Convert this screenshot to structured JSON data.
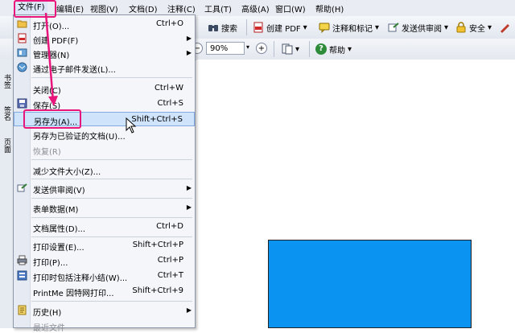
{
  "menubar": {
    "items": [
      "文件(F)",
      "编辑(E)",
      "视图(V)",
      "文档(D)",
      "注释(C)",
      "工具(T)",
      "高级(A)",
      "窗口(W)",
      "帮助(H)"
    ]
  },
  "toolbar": {
    "search_label": "搜索",
    "create_pdf_label": "创建 PDF",
    "comment_label": "注释和标记",
    "send_review_label": "发送供审阅",
    "security_label": "安全"
  },
  "toolbar2": {
    "zoom_value": "90%",
    "help_label": "帮助"
  },
  "leftpanel": {
    "tabs": [
      "书签",
      "签名",
      "页面"
    ]
  },
  "file_menu": {
    "items": [
      {
        "label": "打开(O)...",
        "shortcut": "Ctrl+O",
        "icon": "open-folder-icon"
      },
      {
        "label": "创建 PDF(F)",
        "shortcut": "",
        "icon": "create-pdf-icon",
        "submenu": true
      },
      {
        "label": "管理器(N)",
        "shortcut": "",
        "icon": "organizer-icon",
        "submenu": true
      },
      {
        "label": "通过电子邮件发送(L)...",
        "shortcut": "",
        "icon": "email-icon"
      },
      {
        "label": "关闭(C)",
        "shortcut": "Ctrl+W"
      },
      {
        "label": "保存(S)",
        "shortcut": "Ctrl+S",
        "icon": "save-disk-icon"
      },
      {
        "label": "另存为(A)...",
        "shortcut": "Shift+Ctrl+S"
      },
      {
        "label": "另存为已验证的文档(U)...",
        "shortcut": ""
      },
      {
        "label": "恢复(R)",
        "shortcut": "",
        "disabled": true
      },
      {
        "label": "减少文件大小(Z)...",
        "shortcut": ""
      },
      {
        "label": "发送供审阅(V)",
        "shortcut": "",
        "icon": "send-review-icon",
        "submenu": true
      },
      {
        "label": "表单数据(M)",
        "shortcut": "",
        "submenu": true
      },
      {
        "label": "文档属性(D)...",
        "shortcut": "Ctrl+D"
      },
      {
        "label": "打印设置(E)...",
        "shortcut": "Shift+Ctrl+P"
      },
      {
        "label": "打印(P)...",
        "shortcut": "Ctrl+P",
        "icon": "printer-icon"
      },
      {
        "label": "打印时包括注释小结(W)...",
        "shortcut": "Ctrl+T",
        "icon": "print-summary-icon"
      },
      {
        "label": "PrintMe 因特网打印...",
        "shortcut": "Shift+Ctrl+9"
      },
      {
        "label": "历史(H)",
        "shortcut": "",
        "icon": "history-icon",
        "submenu": true
      },
      {
        "label": "最近文件",
        "shortcut": "",
        "disabled": true
      }
    ]
  },
  "colors": {
    "highlight_box": "#e8157a",
    "hover_bg": "#cfe3fb",
    "document_shape": "#0b93f2"
  }
}
